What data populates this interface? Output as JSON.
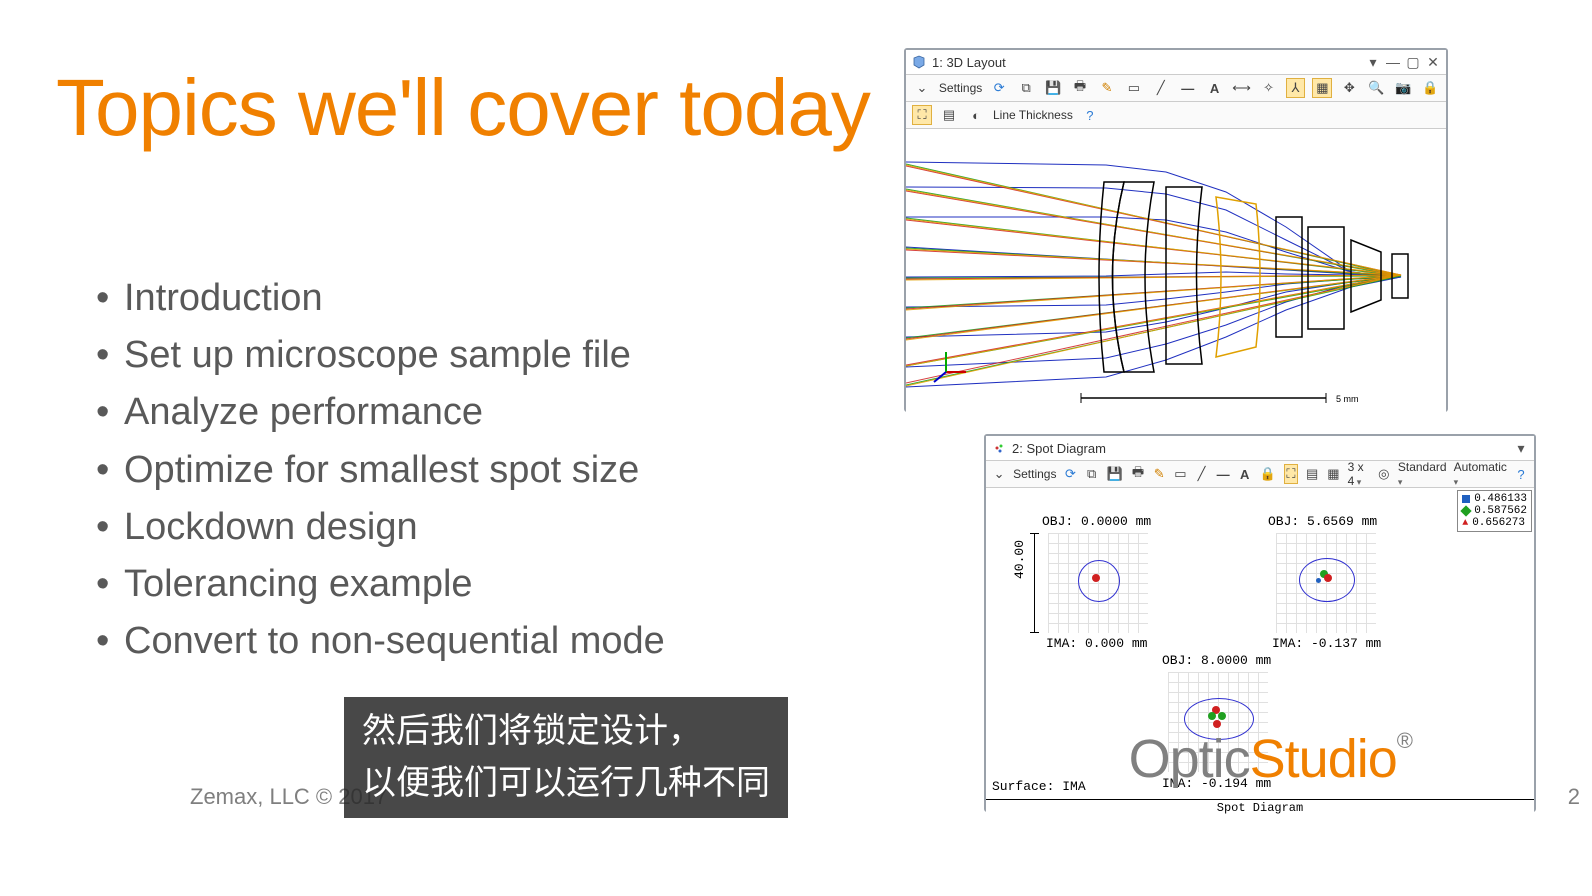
{
  "title": "Topics we'll cover today",
  "bullets": [
    "Introduction",
    "Set up microscope sample file",
    "Analyze performance",
    "Optimize for smallest spot size",
    "Lockdown design",
    "Tolerancing example",
    "Convert to non-sequential mode"
  ],
  "footer": "Zemax, LLC © 2017",
  "page_number": "2",
  "logo": {
    "part1": "Optic",
    "part2": "Studio",
    "reg": "®"
  },
  "caption_line1": "然后我们将锁定设计，",
  "caption_line2": "以便我们可以运行几种不同",
  "win3d": {
    "title": "1: 3D Layout",
    "settings_label": "Settings",
    "line_thickness_label": "Line Thickness",
    "scale_label": "5 mm"
  },
  "winspot": {
    "title": "2: Spot Diagram",
    "settings_label": "Settings",
    "grid_label": "3 x 4",
    "mode1": "Standard",
    "mode2": "Automatic",
    "legend": [
      {
        "color": "#2060c0",
        "sym": "◼",
        "label": "0.486133"
      },
      {
        "color": "#20a020",
        "sym": "◆",
        "label": "0.587562"
      },
      {
        "color": "#d02020",
        "sym": "▲",
        "label": "0.656273"
      }
    ],
    "spots": [
      {
        "obj": "OBJ: 0.0000 mm",
        "ima": "IMA: 0.000 mm"
      },
      {
        "obj": "OBJ: 5.6569 mm",
        "ima": "IMA: -0.137 mm"
      },
      {
        "obj": "OBJ: 8.0000 mm",
        "ima": "IMA: -0.194 mm"
      }
    ],
    "surface_label": "Surface: IMA",
    "footer_label": "Spot Diagram",
    "axis_label": "40.00"
  }
}
